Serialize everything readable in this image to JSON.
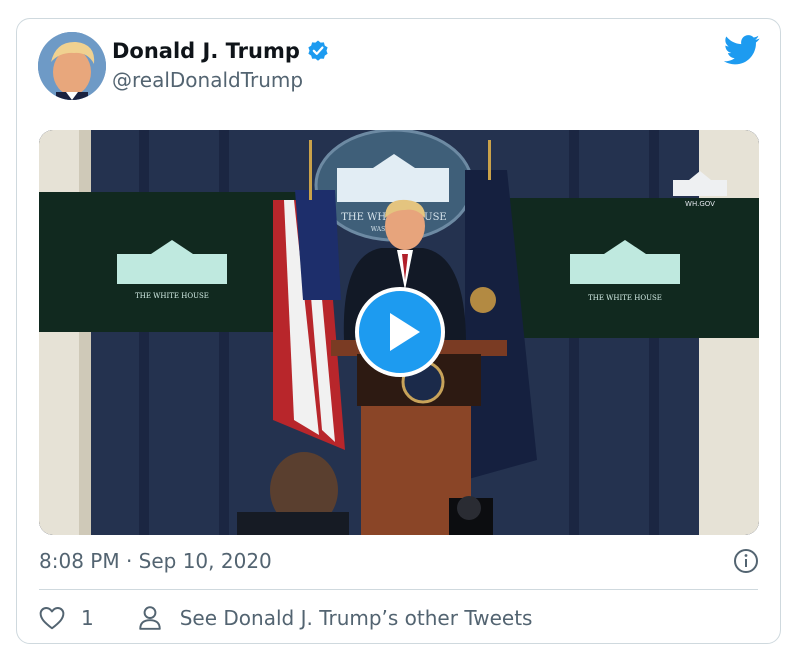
{
  "author": {
    "display_name": "Donald J. Trump",
    "handle": "@realDonaldTrump",
    "verified": true,
    "avatar_icon": "profile-photo"
  },
  "platform_icon": "twitter-bird-icon",
  "media": {
    "type": "video",
    "play_icon": "play-icon",
    "screen_left_caption": "THE WHITE HOUSE",
    "screen_right_caption": "THE WHITE HOUSE",
    "seal_text": "THE WHITE HOUSE",
    "seal_subtext": "WASHINGTON",
    "wh_gov_label": "WH.GOV"
  },
  "timestamp": "8:08 PM · Sep 10, 2020",
  "actions": {
    "like_count": "1",
    "other_tweets_label": "See Donald J. Trump’s other Tweets"
  },
  "colors": {
    "accent": "#1d9bf0",
    "text": "#0f1419",
    "muted": "#536471",
    "border": "#cfd9de"
  }
}
